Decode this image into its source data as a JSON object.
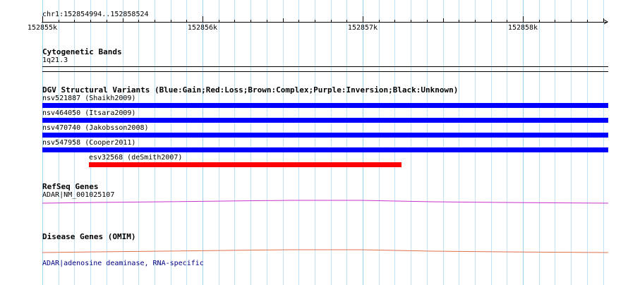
{
  "position_label": "chr1:152854994..152858524",
  "ruler": {
    "ticks": [
      {
        "label": "152855k"
      },
      {
        "label": "152856k"
      },
      {
        "label": "152857k"
      },
      {
        "label": "152858k"
      }
    ]
  },
  "tracks": {
    "cytoband": {
      "title": "Cytogenetic Bands",
      "band": "1q21.3"
    },
    "dgv": {
      "title": "DGV Structural Variants (Blue:Gain;Red:Loss;Brown:Complex;Purple:Inversion;Black:Unknown)",
      "variants": [
        {
          "label": "nsv521887 (Shaikh2009)",
          "type": "gain",
          "color": "#0000ff"
        },
        {
          "label": "nsv464050 (Itsara2009)",
          "type": "gain",
          "color": "#0000ff"
        },
        {
          "label": "nsv470740 (Jakobsson2008)",
          "type": "gain",
          "color": "#0000ff"
        },
        {
          "label": "nsv547958 (Cooper2011)",
          "type": "gain",
          "color": "#0000ff"
        },
        {
          "label": "esv32568 (deSmith2007)",
          "type": "loss",
          "color": "#ff0000"
        }
      ]
    },
    "refseq": {
      "title": "RefSeq Genes",
      "gene_label": "ADAR|NM_001025107",
      "color": "#cc33cc"
    },
    "disease": {
      "title": "Disease Genes (OMIM)",
      "gene_label": "ADAR|adenosine deaminase, RNA-specific",
      "color": "#e07050",
      "label_color": "#000080"
    }
  }
}
